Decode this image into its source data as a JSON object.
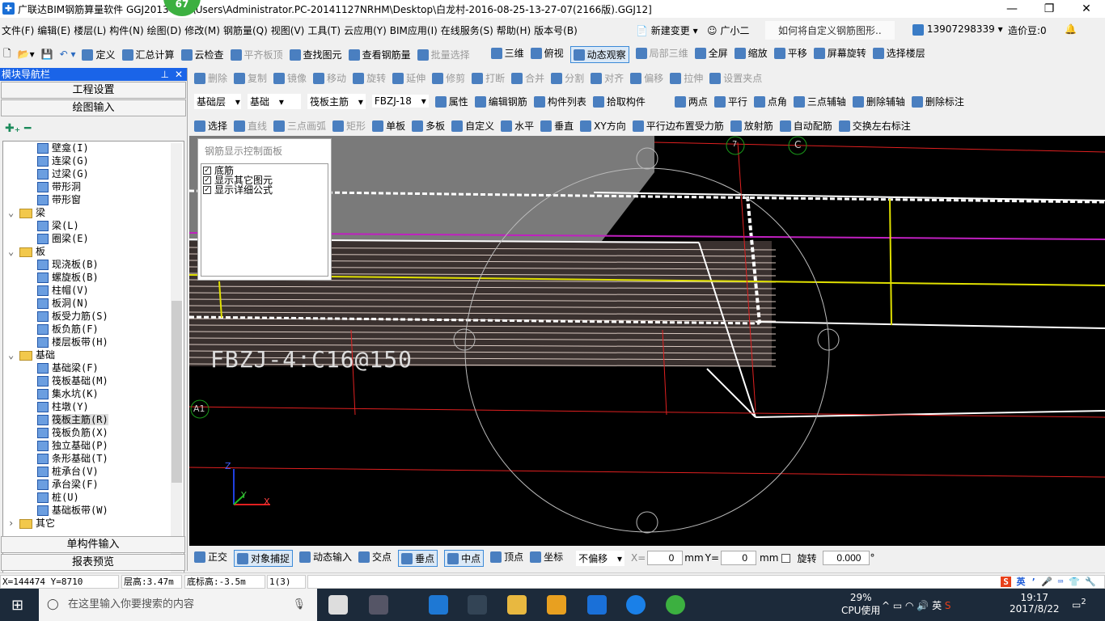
{
  "window": {
    "title": "广联达BIM钢筋算量软件 GGJ2013 - [C:\\Users\\Administrator.PC-20141127NRHM\\Desktop\\白龙村-2016-08-25-13-27-07(2166版).GGJ12]",
    "badge": "67",
    "minimize": "—",
    "restore": "❐",
    "close": "✕"
  },
  "menu": [
    "文件(F)",
    "编辑(E)",
    "楼层(L)",
    "构件(N)",
    "绘图(D)",
    "修改(M)",
    "钢筋量(Q)",
    "视图(V)",
    "工具(T)",
    "云应用(Y)",
    "BIM应用(I)",
    "在线服务(S)",
    "帮助(H)",
    "版本号(B)"
  ],
  "menu_right": {
    "new_change": "新建变更",
    "assistant": "广小二",
    "question": "如何将自定义钢筋图形..",
    "phone": "13907298339",
    "beans": "造价豆:0"
  },
  "toolbar1": [
    "定义",
    "汇总计算",
    "云检查",
    "平齐板顶",
    "查找图元",
    "查看钢筋量",
    "批量选择"
  ],
  "toolbar1_right": [
    "三维",
    "俯视",
    "动态观察",
    "局部三维",
    "全屏",
    "缩放",
    "平移",
    "屏幕旋转",
    "选择楼层"
  ],
  "toolbar2": [
    "删除",
    "复制",
    "镜像",
    "移动",
    "旋转",
    "延伸",
    "修剪",
    "打断",
    "合并",
    "分割",
    "对齐",
    "偏移",
    "拉伸",
    "设置夹点"
  ],
  "toolbar3": {
    "floor": "基础层",
    "category": "基础",
    "type": "筏板主筋",
    "name": "FBZJ-18",
    "buttons": [
      "属性",
      "编辑钢筋",
      "构件列表",
      "拾取构件"
    ],
    "right": [
      "两点",
      "平行",
      "点角",
      "三点辅轴",
      "删除辅轴",
      "删除标注"
    ]
  },
  "toolbar4": [
    "选择",
    "直线",
    "三点画弧",
    "矩形",
    "单板",
    "多板",
    "自定义",
    "水平",
    "垂直",
    "XY方向",
    "平行边布置受力筋",
    "放射筋",
    "自动配筋",
    "交换左右标注"
  ],
  "nav": {
    "title": "模块导航栏",
    "buttons_top": [
      "工程设置",
      "绘图输入"
    ],
    "buttons_bottom": [
      "单构件输入",
      "报表预览"
    ],
    "tree": [
      {
        "label": "壁龛(I)",
        "level": 2
      },
      {
        "label": "连梁(G)",
        "level": 2
      },
      {
        "label": "过梁(G)",
        "level": 2
      },
      {
        "label": "带形洞",
        "level": 2
      },
      {
        "label": "带形窗",
        "level": 2
      },
      {
        "label": "梁",
        "level": 1,
        "folder": true
      },
      {
        "label": "梁(L)",
        "level": 2
      },
      {
        "label": "圈梁(E)",
        "level": 2
      },
      {
        "label": "板",
        "level": 1,
        "folder": true
      },
      {
        "label": "现浇板(B)",
        "level": 2
      },
      {
        "label": "螺旋板(B)",
        "level": 2
      },
      {
        "label": "柱帽(V)",
        "level": 2
      },
      {
        "label": "板洞(N)",
        "level": 2
      },
      {
        "label": "板受力筋(S)",
        "level": 2
      },
      {
        "label": "板负筋(F)",
        "level": 2
      },
      {
        "label": "楼层板带(H)",
        "level": 2
      },
      {
        "label": "基础",
        "level": 1,
        "folder": true
      },
      {
        "label": "基础梁(F)",
        "level": 2
      },
      {
        "label": "筏板基础(M)",
        "level": 2
      },
      {
        "label": "集水坑(K)",
        "level": 2
      },
      {
        "label": "柱墩(Y)",
        "level": 2
      },
      {
        "label": "筏板主筋(R)",
        "level": 2,
        "selected": true
      },
      {
        "label": "筏板负筋(X)",
        "level": 2
      },
      {
        "label": "独立基础(P)",
        "level": 2
      },
      {
        "label": "条形基础(T)",
        "level": 2
      },
      {
        "label": "桩承台(V)",
        "level": 2
      },
      {
        "label": "承台梁(F)",
        "level": 2
      },
      {
        "label": "桩(U)",
        "level": 2
      },
      {
        "label": "基础板带(W)",
        "level": 2
      },
      {
        "label": "其它",
        "level": 1,
        "folder": true,
        "collapsed": true
      }
    ]
  },
  "panel": {
    "title": "钢筋显示控制面板",
    "items": [
      {
        "label": "底筋",
        "checked": true
      },
      {
        "label": "显示其它图元",
        "checked": true
      },
      {
        "label": "显示详细公式",
        "checked": true
      }
    ]
  },
  "canvas": {
    "annotation": "FBZJ-4:C16@150",
    "axis_7": "7",
    "axis_c": "C",
    "axis_a1": "A1",
    "z": "Z",
    "y": "Y",
    "x": "X"
  },
  "snapbar": {
    "items": [
      "正交",
      "对象捕捉",
      "动态输入",
      "交点",
      "垂点",
      "中点",
      "顶点",
      "坐标"
    ],
    "offset": "不偏移",
    "x_label": "X=",
    "x_val": "0",
    "unit": "mm",
    "y_label": "Y=",
    "y_val": "0",
    "rotate": "旋转",
    "rotate_val": "0.000",
    "deg": "°"
  },
  "status": {
    "coords": "X=144474 Y=8710",
    "floor_height": "层高:3.47m",
    "base_elev": "底标高:-3.5m",
    "count": "1(3)"
  },
  "taskbar": {
    "search": "在这里输入你要搜索的内容",
    "cpu": "29%",
    "cpu_label": "CPU使用",
    "ime": "英",
    "time": "19:17",
    "date": "2017/8/22",
    "notif": "2"
  }
}
